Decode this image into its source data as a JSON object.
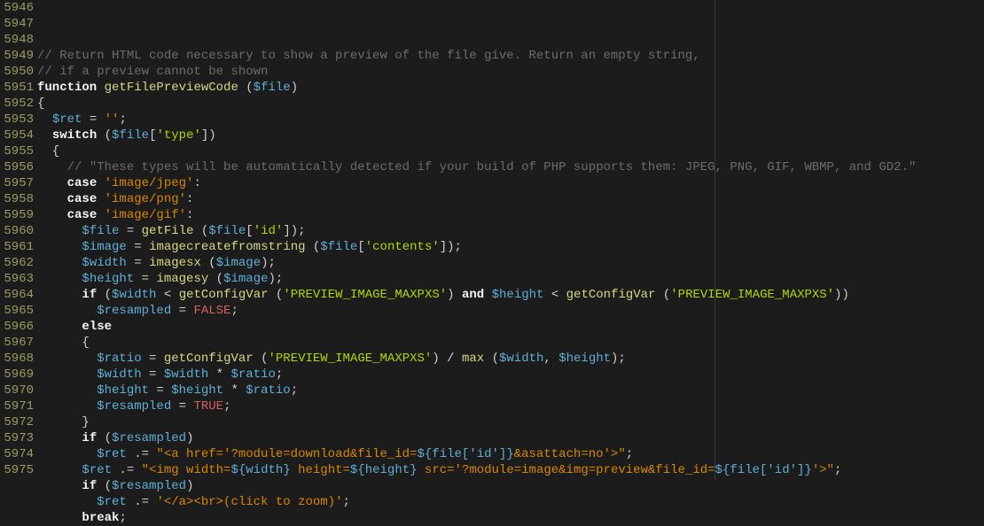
{
  "editor": {
    "first_line_number": 5946,
    "ruler_column": 85,
    "lines": [
      [
        {
          "cls": "c-comment",
          "text": "// Return HTML code necessary to show a preview of the file give. Return an empty string,"
        }
      ],
      [
        {
          "cls": "c-comment",
          "text": "// if a preview cannot be shown"
        }
      ],
      [
        {
          "cls": "c-kw",
          "text": "function"
        },
        {
          "cls": "c-plain",
          "text": " "
        },
        {
          "cls": "c-func",
          "text": "getFilePreviewCode"
        },
        {
          "cls": "c-plain",
          "text": " ("
        },
        {
          "cls": "c-var",
          "text": "$file"
        },
        {
          "cls": "c-plain",
          "text": ")"
        }
      ],
      [
        {
          "cls": "c-plain",
          "text": "{"
        }
      ],
      [
        {
          "cls": "c-plain",
          "text": "  "
        },
        {
          "cls": "c-var",
          "text": "$ret"
        },
        {
          "cls": "c-plain",
          "text": " = "
        },
        {
          "cls": "c-str",
          "text": "''"
        },
        {
          "cls": "c-plain",
          "text": ";"
        }
      ],
      [
        {
          "cls": "c-plain",
          "text": "  "
        },
        {
          "cls": "c-kw",
          "text": "switch"
        },
        {
          "cls": "c-plain",
          "text": " ("
        },
        {
          "cls": "c-var",
          "text": "$file"
        },
        {
          "cls": "c-plain",
          "text": "["
        },
        {
          "cls": "c-strkey",
          "text": "'type'"
        },
        {
          "cls": "c-plain",
          "text": "])"
        }
      ],
      [
        {
          "cls": "c-plain",
          "text": "  {"
        }
      ],
      [
        {
          "cls": "c-plain",
          "text": "    "
        },
        {
          "cls": "c-comment",
          "text": "// \"These types will be automatically detected if your build of PHP supports them: JPEG, PNG, GIF, WBMP, and GD2.\""
        }
      ],
      [
        {
          "cls": "c-plain",
          "text": "    "
        },
        {
          "cls": "c-kw",
          "text": "case"
        },
        {
          "cls": "c-plain",
          "text": " "
        },
        {
          "cls": "c-str",
          "text": "'image/jpeg'"
        },
        {
          "cls": "c-plain",
          "text": ":"
        }
      ],
      [
        {
          "cls": "c-plain",
          "text": "    "
        },
        {
          "cls": "c-kw",
          "text": "case"
        },
        {
          "cls": "c-plain",
          "text": " "
        },
        {
          "cls": "c-str",
          "text": "'image/png'"
        },
        {
          "cls": "c-plain",
          "text": ":"
        }
      ],
      [
        {
          "cls": "c-plain",
          "text": "    "
        },
        {
          "cls": "c-kw",
          "text": "case"
        },
        {
          "cls": "c-plain",
          "text": " "
        },
        {
          "cls": "c-str",
          "text": "'image/gif'"
        },
        {
          "cls": "c-plain",
          "text": ":"
        }
      ],
      [
        {
          "cls": "c-plain",
          "text": "      "
        },
        {
          "cls": "c-var",
          "text": "$file"
        },
        {
          "cls": "c-plain",
          "text": " = "
        },
        {
          "cls": "c-func",
          "text": "getFile"
        },
        {
          "cls": "c-plain",
          "text": " ("
        },
        {
          "cls": "c-var",
          "text": "$file"
        },
        {
          "cls": "c-plain",
          "text": "["
        },
        {
          "cls": "c-strkey",
          "text": "'id'"
        },
        {
          "cls": "c-plain",
          "text": "]);"
        }
      ],
      [
        {
          "cls": "c-plain",
          "text": "      "
        },
        {
          "cls": "c-var",
          "text": "$image"
        },
        {
          "cls": "c-plain",
          "text": " = "
        },
        {
          "cls": "c-func",
          "text": "imagecreatefromstring"
        },
        {
          "cls": "c-plain",
          "text": " ("
        },
        {
          "cls": "c-var",
          "text": "$file"
        },
        {
          "cls": "c-plain",
          "text": "["
        },
        {
          "cls": "c-strkey",
          "text": "'contents'"
        },
        {
          "cls": "c-plain",
          "text": "]);"
        }
      ],
      [
        {
          "cls": "c-plain",
          "text": "      "
        },
        {
          "cls": "c-var",
          "text": "$width"
        },
        {
          "cls": "c-plain",
          "text": " = "
        },
        {
          "cls": "c-func",
          "text": "imagesx"
        },
        {
          "cls": "c-plain",
          "text": " ("
        },
        {
          "cls": "c-var",
          "text": "$image"
        },
        {
          "cls": "c-plain",
          "text": ");"
        }
      ],
      [
        {
          "cls": "c-plain",
          "text": "      "
        },
        {
          "cls": "c-var",
          "text": "$height"
        },
        {
          "cls": "c-plain",
          "text": " = "
        },
        {
          "cls": "c-func",
          "text": "imagesy"
        },
        {
          "cls": "c-plain",
          "text": " ("
        },
        {
          "cls": "c-var",
          "text": "$image"
        },
        {
          "cls": "c-plain",
          "text": ");"
        }
      ],
      [
        {
          "cls": "c-plain",
          "text": "      "
        },
        {
          "cls": "c-kw",
          "text": "if"
        },
        {
          "cls": "c-plain",
          "text": " ("
        },
        {
          "cls": "c-var",
          "text": "$width"
        },
        {
          "cls": "c-plain",
          "text": " < "
        },
        {
          "cls": "c-func",
          "text": "getConfigVar"
        },
        {
          "cls": "c-plain",
          "text": " ("
        },
        {
          "cls": "c-strkey",
          "text": "'PREVIEW_IMAGE_MAXPXS'"
        },
        {
          "cls": "c-plain",
          "text": ") "
        },
        {
          "cls": "c-kw",
          "text": "and"
        },
        {
          "cls": "c-plain",
          "text": " "
        },
        {
          "cls": "c-var",
          "text": "$height"
        },
        {
          "cls": "c-plain",
          "text": " < "
        },
        {
          "cls": "c-func",
          "text": "getConfigVar"
        },
        {
          "cls": "c-plain",
          "text": " ("
        },
        {
          "cls": "c-strkey",
          "text": "'PREVIEW_IMAGE_MAXPXS'"
        },
        {
          "cls": "c-plain",
          "text": "))"
        }
      ],
      [
        {
          "cls": "c-plain",
          "text": "        "
        },
        {
          "cls": "c-var",
          "text": "$resampled"
        },
        {
          "cls": "c-plain",
          "text": " = "
        },
        {
          "cls": "c-bool",
          "text": "FALSE"
        },
        {
          "cls": "c-plain",
          "text": ";"
        }
      ],
      [
        {
          "cls": "c-plain",
          "text": "      "
        },
        {
          "cls": "c-kw",
          "text": "else"
        }
      ],
      [
        {
          "cls": "c-plain",
          "text": "      {"
        }
      ],
      [
        {
          "cls": "c-plain",
          "text": "        "
        },
        {
          "cls": "c-var",
          "text": "$ratio"
        },
        {
          "cls": "c-plain",
          "text": " = "
        },
        {
          "cls": "c-func",
          "text": "getConfigVar"
        },
        {
          "cls": "c-plain",
          "text": " ("
        },
        {
          "cls": "c-strkey",
          "text": "'PREVIEW_IMAGE_MAXPXS'"
        },
        {
          "cls": "c-plain",
          "text": ") / "
        },
        {
          "cls": "c-func",
          "text": "max"
        },
        {
          "cls": "c-plain",
          "text": " ("
        },
        {
          "cls": "c-var",
          "text": "$width"
        },
        {
          "cls": "c-plain",
          "text": ", "
        },
        {
          "cls": "c-var",
          "text": "$height"
        },
        {
          "cls": "c-plain",
          "text": ");"
        }
      ],
      [
        {
          "cls": "c-plain",
          "text": "        "
        },
        {
          "cls": "c-var",
          "text": "$width"
        },
        {
          "cls": "c-plain",
          "text": " = "
        },
        {
          "cls": "c-var",
          "text": "$width"
        },
        {
          "cls": "c-plain",
          "text": " * "
        },
        {
          "cls": "c-var",
          "text": "$ratio"
        },
        {
          "cls": "c-plain",
          "text": ";"
        }
      ],
      [
        {
          "cls": "c-plain",
          "text": "        "
        },
        {
          "cls": "c-var",
          "text": "$height"
        },
        {
          "cls": "c-plain",
          "text": " = "
        },
        {
          "cls": "c-var",
          "text": "$height"
        },
        {
          "cls": "c-plain",
          "text": " * "
        },
        {
          "cls": "c-var",
          "text": "$ratio"
        },
        {
          "cls": "c-plain",
          "text": ";"
        }
      ],
      [
        {
          "cls": "c-plain",
          "text": "        "
        },
        {
          "cls": "c-var",
          "text": "$resampled"
        },
        {
          "cls": "c-plain",
          "text": " = "
        },
        {
          "cls": "c-bool",
          "text": "TRUE"
        },
        {
          "cls": "c-plain",
          "text": ";"
        }
      ],
      [
        {
          "cls": "c-plain",
          "text": "      }"
        }
      ],
      [
        {
          "cls": "c-plain",
          "text": "      "
        },
        {
          "cls": "c-kw",
          "text": "if"
        },
        {
          "cls": "c-plain",
          "text": " ("
        },
        {
          "cls": "c-var",
          "text": "$resampled"
        },
        {
          "cls": "c-plain",
          "text": ")"
        }
      ],
      [
        {
          "cls": "c-plain",
          "text": "        "
        },
        {
          "cls": "c-var",
          "text": "$ret"
        },
        {
          "cls": "c-plain",
          "text": " .= "
        },
        {
          "cls": "c-str",
          "text": "\"<a href='?module=download&file_id="
        },
        {
          "cls": "c-var",
          "text": "${file['id']}"
        },
        {
          "cls": "c-str",
          "text": "&asattach=no'>\""
        },
        {
          "cls": "c-plain",
          "text": ";"
        }
      ],
      [
        {
          "cls": "c-plain",
          "text": "      "
        },
        {
          "cls": "c-var",
          "text": "$ret"
        },
        {
          "cls": "c-plain",
          "text": " .= "
        },
        {
          "cls": "c-str",
          "text": "\"<img width="
        },
        {
          "cls": "c-var",
          "text": "${width}"
        },
        {
          "cls": "c-str",
          "text": " height="
        },
        {
          "cls": "c-var",
          "text": "${height}"
        },
        {
          "cls": "c-str",
          "text": " src='?module=image&img=preview&file_id="
        },
        {
          "cls": "c-var",
          "text": "${file['id']}"
        },
        {
          "cls": "c-str",
          "text": "'>\""
        },
        {
          "cls": "c-plain",
          "text": ";"
        }
      ],
      [
        {
          "cls": "c-plain",
          "text": "      "
        },
        {
          "cls": "c-kw",
          "text": "if"
        },
        {
          "cls": "c-plain",
          "text": " ("
        },
        {
          "cls": "c-var",
          "text": "$resampled"
        },
        {
          "cls": "c-plain",
          "text": ")"
        }
      ],
      [
        {
          "cls": "c-plain",
          "text": "        "
        },
        {
          "cls": "c-var",
          "text": "$ret"
        },
        {
          "cls": "c-plain",
          "text": " .= "
        },
        {
          "cls": "c-str",
          "text": "'</a><br>(click to zoom)'"
        },
        {
          "cls": "c-plain",
          "text": ";"
        }
      ],
      [
        {
          "cls": "c-plain",
          "text": "      "
        },
        {
          "cls": "c-kw",
          "text": "break"
        },
        {
          "cls": "c-plain",
          "text": ";"
        }
      ]
    ]
  }
}
